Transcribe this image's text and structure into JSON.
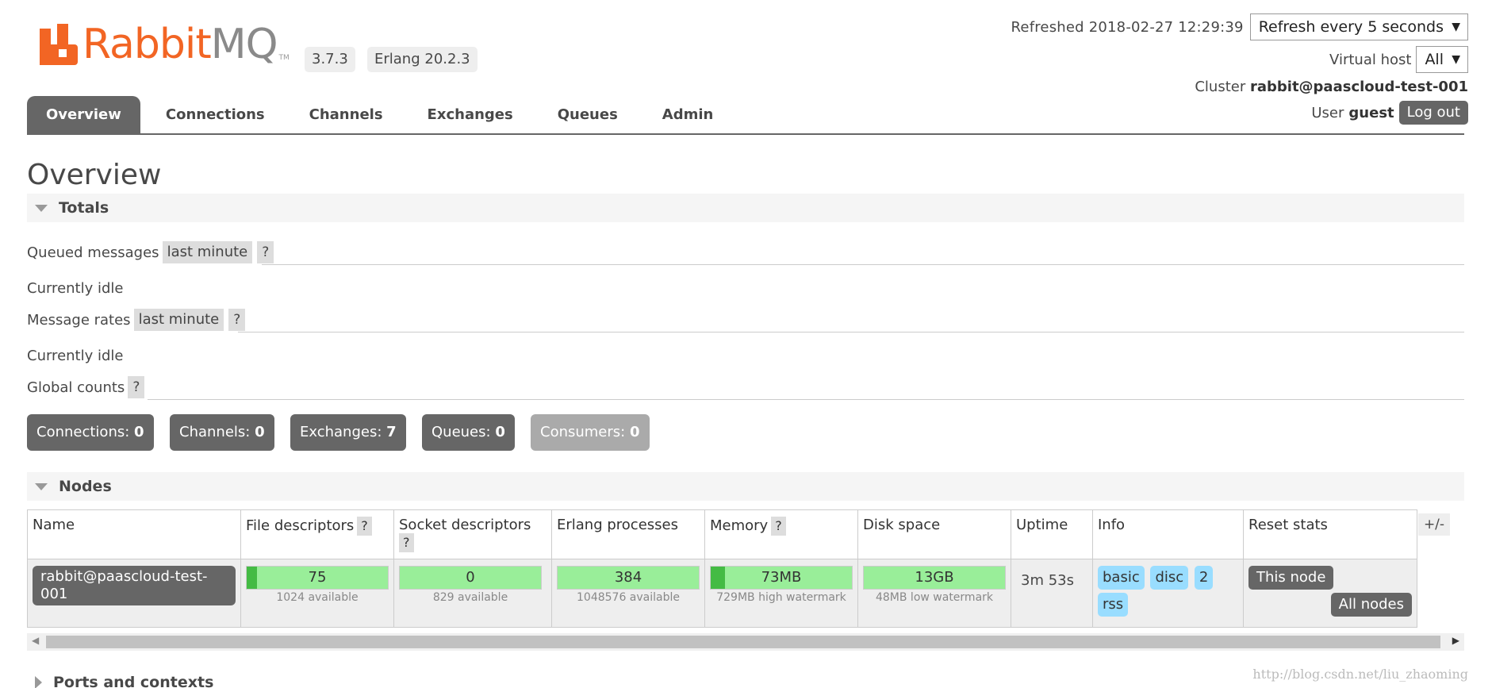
{
  "header": {
    "logo_text_rabbit": "Rabbit",
    "logo_text_mq": "MQ",
    "logo_tm": "TM",
    "version": "3.7.3",
    "erlang": "Erlang 20.2.3",
    "refreshed": "Refreshed 2018-02-27 12:29:39",
    "refresh_select": "Refresh every 5 seconds",
    "vhost_label": "Virtual host",
    "vhost_value": "All",
    "cluster_label": "Cluster",
    "cluster_name": "rabbit@paascloud-test-001",
    "user_label": "User",
    "user_name": "guest",
    "logout": "Log out"
  },
  "tabs": [
    {
      "label": "Overview",
      "active": true
    },
    {
      "label": "Connections"
    },
    {
      "label": "Channels"
    },
    {
      "label": "Exchanges"
    },
    {
      "label": "Queues"
    },
    {
      "label": "Admin"
    }
  ],
  "page_title": "Overview",
  "totals": {
    "title": "Totals",
    "queued_label": "Queued messages",
    "queued_period": "last minute",
    "help": "?",
    "queued_status": "Currently idle",
    "rates_label": "Message rates",
    "rates_period": "last minute",
    "rates_status": "Currently idle",
    "global_label": "Global counts",
    "counts": [
      {
        "label": "Connections:",
        "value": "0"
      },
      {
        "label": "Channels:",
        "value": "0"
      },
      {
        "label": "Exchanges:",
        "value": "7"
      },
      {
        "label": "Queues:",
        "value": "0"
      },
      {
        "label": "Consumers:",
        "value": "0"
      }
    ]
  },
  "nodes": {
    "title": "Nodes",
    "plus_minus": "+/-",
    "columns": [
      "Name",
      "File descriptors",
      "Socket descriptors",
      "Erlang processes",
      "Memory",
      "Disk space",
      "Uptime",
      "Info",
      "Reset stats"
    ],
    "row": {
      "name": "rabbit@paascloud-test-001",
      "file_desc": {
        "value": "75",
        "sub": "1024 available",
        "fraction": 0.073
      },
      "socket_desc": {
        "value": "0",
        "sub": "829 available",
        "fraction": 0.0
      },
      "erlang_proc": {
        "value": "384",
        "sub": "1048576 available",
        "fraction": 0.0004
      },
      "memory": {
        "value": "73MB",
        "sub": "729MB high watermark",
        "fraction": 0.1
      },
      "disk": {
        "value": "13GB",
        "sub": "48MB low watermark",
        "fraction": 0.0
      },
      "uptime": "3m 53s",
      "info_tags": [
        "basic",
        "disc",
        "2",
        "rss"
      ],
      "reset_this": "This node",
      "reset_all": "All nodes"
    }
  },
  "ports_title": "Ports and contexts",
  "watermark": "http://blog.csdn.net/liu_zhaoming",
  "colors": {
    "brand_orange": "#f26524",
    "tab_active": "#666666",
    "meter_green": "#99ee99",
    "info_blue": "#99ddff"
  }
}
